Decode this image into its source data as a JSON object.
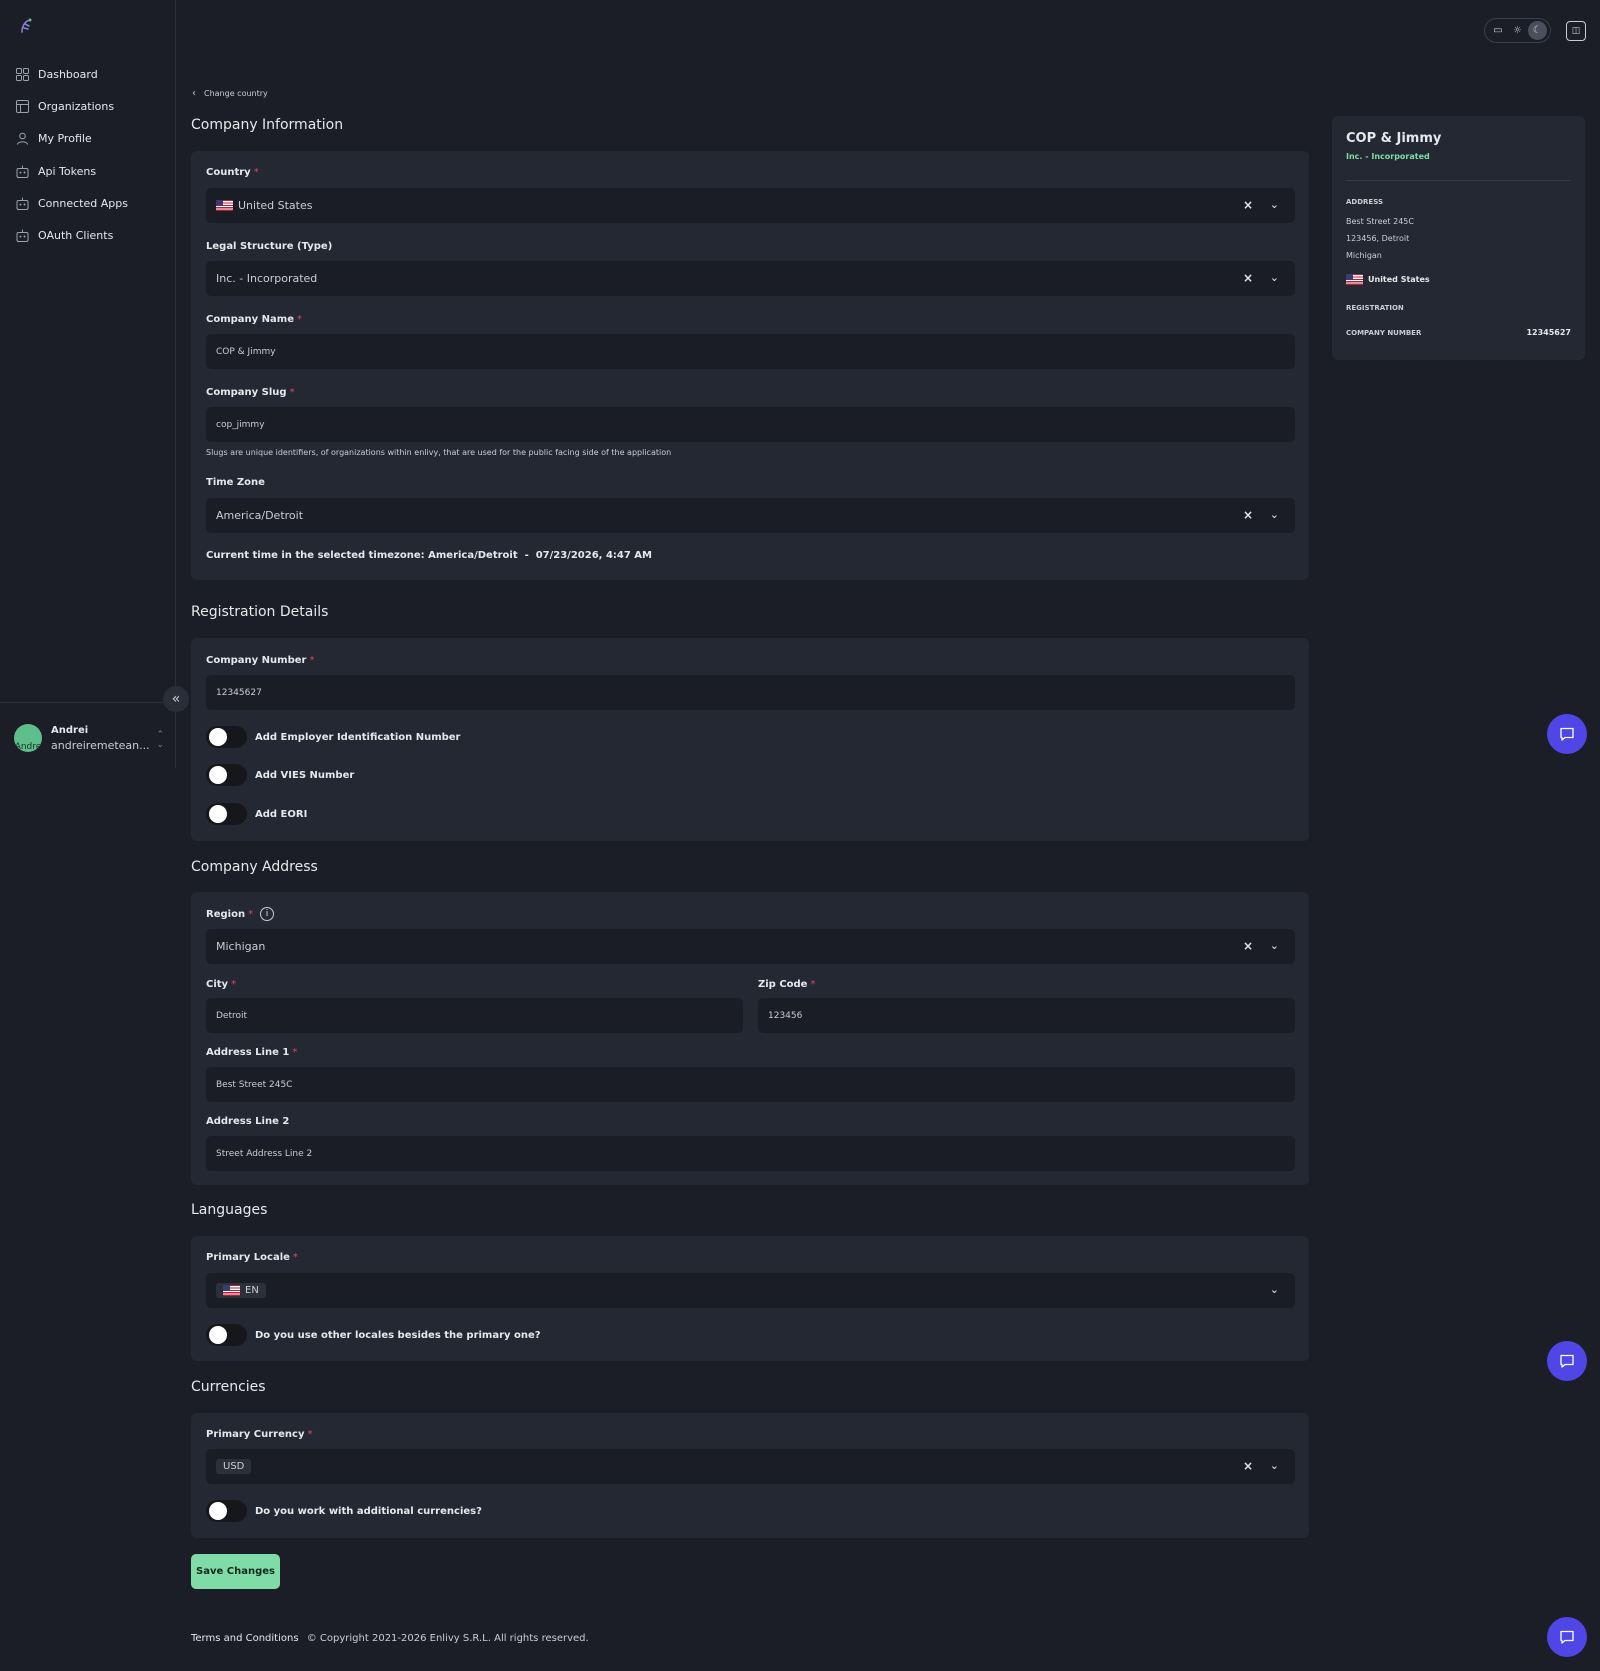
{
  "sidebar": {
    "items": [
      {
        "label": "Dashboard",
        "icon": "grid-icon"
      },
      {
        "label": "Organizations",
        "icon": "table-icon"
      },
      {
        "label": "My Profile",
        "icon": "user-icon"
      },
      {
        "label": "Api Tokens",
        "icon": "robot-icon"
      },
      {
        "label": "Connected Apps",
        "icon": "robot-icon"
      },
      {
        "label": "OAuth Clients",
        "icon": "robot-icon"
      }
    ],
    "user": {
      "name": "Andrei",
      "email": "andreiremetean...",
      "avatar_text": "Andre"
    }
  },
  "back_link": "Change country",
  "company_info": {
    "title": "Company Information",
    "country_label": "Country",
    "country_value": "United States",
    "legal_label": "Legal Structure (Type)",
    "legal_value": "Inc. - Incorporated",
    "name_label": "Company Name",
    "name_value": "COP & Jimmy",
    "slug_label": "Company Slug",
    "slug_value": "cop_jimmy",
    "slug_helper": "Slugs are unique identifiers, of organizations within enlivy, that are used for the public facing side of the application",
    "tz_label": "Time Zone",
    "tz_value": "America/Detroit",
    "current_time": "Current time in the selected timezone: America/Detroit  -  07/23/2026, 4:47 AM"
  },
  "registration": {
    "title": "Registration Details",
    "number_label": "Company Number",
    "number_value": "12345627",
    "toggle_ein": "Add Employer Identification Number",
    "toggle_vies": "Add VIES Number",
    "toggle_eori": "Add EORI"
  },
  "address": {
    "title": "Company Address",
    "region_label": "Region",
    "region_value": "Michigan",
    "city_label": "City",
    "city_value": "Detroit",
    "zip_label": "Zip Code",
    "zip_value": "123456",
    "line1_label": "Address Line 1",
    "line1_value": "Best Street 245C",
    "line2_label": "Address Line 2",
    "line2_placeholder": "Street Address Line 2"
  },
  "languages": {
    "title": "Languages",
    "locale_label": "Primary Locale",
    "locale_value": "EN",
    "toggle_other": "Do you use other locales besides the primary one?"
  },
  "currencies": {
    "title": "Currencies",
    "currency_label": "Primary Currency",
    "currency_value": "USD",
    "toggle_additional": "Do you work with additional currencies?"
  },
  "save_label": "Save Changes",
  "footer": {
    "terms": "Terms and Conditions",
    "copyright": "© Copyright 2021-2026 Enlivy S.R.L. All rights reserved."
  },
  "summary": {
    "name": "COP & Jimmy",
    "type": "Inc. - Incorporated",
    "address_heading": "ADDRESS",
    "address_line1": "Best Street 245C",
    "address_line2": "123456, Detroit",
    "address_line3": "Michigan",
    "country": "United States",
    "registration_heading": "REGISTRATION",
    "company_number_label": "COMPANY NUMBER",
    "company_number_value": "12345627"
  },
  "colors": {
    "background": "#1b1e26",
    "card": "#242833",
    "accent_green": "#7fdca6",
    "chat_button": "#4f46e5",
    "required": "#d94b5e"
  }
}
